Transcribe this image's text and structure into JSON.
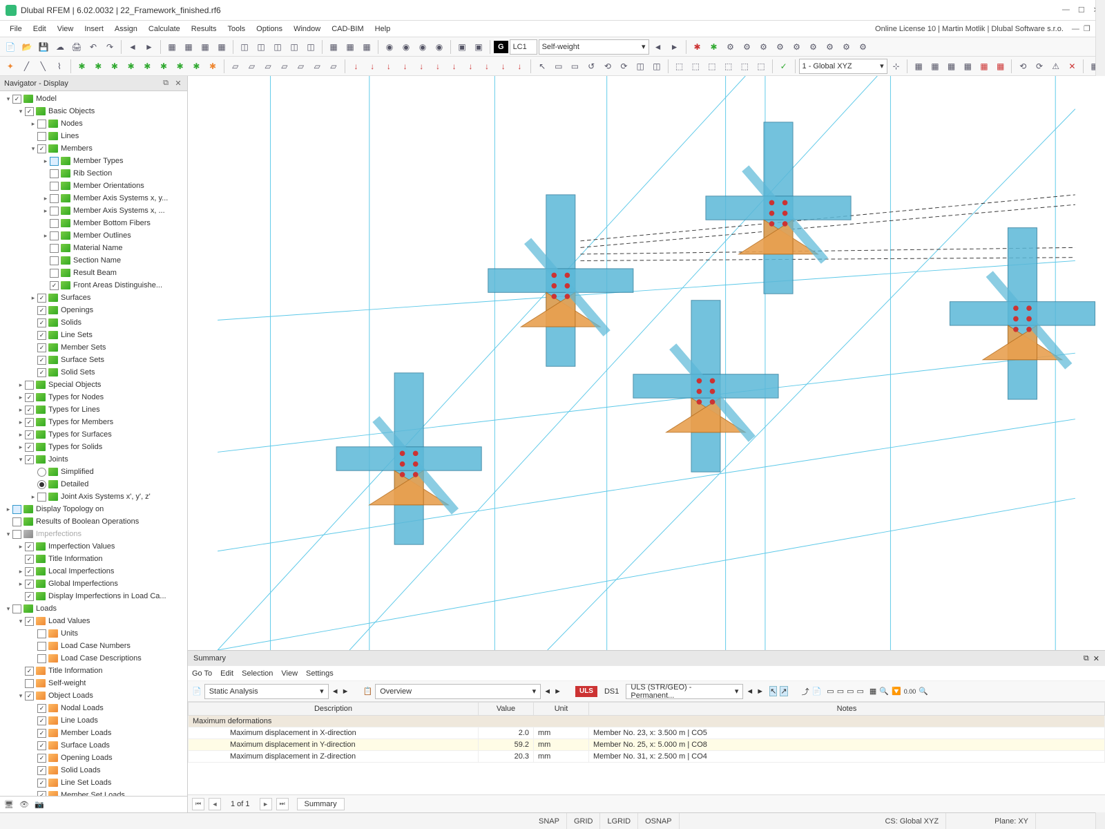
{
  "title": "Dlubal RFEM | 6.02.0032 | 22_Framework_finished.rf6",
  "menubar": [
    "File",
    "Edit",
    "View",
    "Insert",
    "Assign",
    "Calculate",
    "Results",
    "Tools",
    "Options",
    "Window",
    "CAD-BIM",
    "Help"
  ],
  "right_info": "Online License 10 | Martin Motlik | Dlubal Software s.r.o.",
  "toolbar1": {
    "lc_badge": "G",
    "lc_code": "LC1",
    "lc_name": "Self-weight"
  },
  "toolbar2": {
    "cs_combo": "1 - Global XYZ"
  },
  "navigator": {
    "title": "Navigator - Display",
    "tree": [
      {
        "lvl": 0,
        "exp": "▾",
        "chk": 1,
        "ic": "green",
        "label": "Model"
      },
      {
        "lvl": 1,
        "exp": "▾",
        "chk": 1,
        "ic": "green",
        "label": "Basic Objects"
      },
      {
        "lvl": 2,
        "exp": "▸",
        "chk": 0,
        "ic": "green",
        "label": "Nodes"
      },
      {
        "lvl": 2,
        "exp": "",
        "chk": 0,
        "ic": "green",
        "label": "Lines"
      },
      {
        "lvl": 2,
        "exp": "▾",
        "chk": 1,
        "ic": "green",
        "label": "Members"
      },
      {
        "lvl": 3,
        "exp": "▸",
        "chk": 0,
        "chkstyle": "blue",
        "ic": "green",
        "label": "Member Types"
      },
      {
        "lvl": 3,
        "exp": "",
        "chk": 0,
        "ic": "green",
        "label": "Rib Section"
      },
      {
        "lvl": 3,
        "exp": "",
        "chk": 0,
        "ic": "green",
        "label": "Member Orientations"
      },
      {
        "lvl": 3,
        "exp": "▸",
        "chk": 0,
        "ic": "green",
        "label": "Member Axis Systems x, y..."
      },
      {
        "lvl": 3,
        "exp": "▸",
        "chk": 0,
        "ic": "green",
        "label": "Member Axis Systems x, ..."
      },
      {
        "lvl": 3,
        "exp": "",
        "chk": 0,
        "ic": "green",
        "label": "Member Bottom Fibers"
      },
      {
        "lvl": 3,
        "exp": "▸",
        "chk": 0,
        "ic": "green",
        "label": "Member Outlines"
      },
      {
        "lvl": 3,
        "exp": "",
        "chk": 0,
        "ic": "green",
        "label": "Material Name"
      },
      {
        "lvl": 3,
        "exp": "",
        "chk": 0,
        "ic": "green",
        "label": "Section Name"
      },
      {
        "lvl": 3,
        "exp": "",
        "chk": 0,
        "ic": "green",
        "label": "Result Beam"
      },
      {
        "lvl": 3,
        "exp": "",
        "chk": 1,
        "ic": "green",
        "label": "Front Areas Distinguishe..."
      },
      {
        "lvl": 2,
        "exp": "▸",
        "chk": 1,
        "ic": "green",
        "label": "Surfaces"
      },
      {
        "lvl": 2,
        "exp": "",
        "chk": 1,
        "ic": "green",
        "label": "Openings"
      },
      {
        "lvl": 2,
        "exp": "",
        "chk": 1,
        "ic": "green",
        "label": "Solids"
      },
      {
        "lvl": 2,
        "exp": "",
        "chk": 1,
        "ic": "green",
        "label": "Line Sets"
      },
      {
        "lvl": 2,
        "exp": "",
        "chk": 1,
        "ic": "green",
        "label": "Member Sets"
      },
      {
        "lvl": 2,
        "exp": "",
        "chk": 1,
        "ic": "green",
        "label": "Surface Sets"
      },
      {
        "lvl": 2,
        "exp": "",
        "chk": 1,
        "ic": "green",
        "label": "Solid Sets"
      },
      {
        "lvl": 1,
        "exp": "▸",
        "chk": 0,
        "ic": "green",
        "label": "Special Objects"
      },
      {
        "lvl": 1,
        "exp": "▸",
        "chk": 1,
        "ic": "green",
        "label": "Types for Nodes"
      },
      {
        "lvl": 1,
        "exp": "▸",
        "chk": 1,
        "ic": "green",
        "label": "Types for Lines"
      },
      {
        "lvl": 1,
        "exp": "▸",
        "chk": 1,
        "ic": "green",
        "label": "Types for Members"
      },
      {
        "lvl": 1,
        "exp": "▸",
        "chk": 1,
        "ic": "green",
        "label": "Types for Surfaces"
      },
      {
        "lvl": 1,
        "exp": "▸",
        "chk": 1,
        "ic": "green",
        "label": "Types for Solids"
      },
      {
        "lvl": 1,
        "exp": "▾",
        "chk": 1,
        "ic": "green",
        "label": "Joints"
      },
      {
        "lvl": 2,
        "exp": "",
        "radio": 0,
        "ic": "green",
        "label": "Simplified"
      },
      {
        "lvl": 2,
        "exp": "",
        "radio": 1,
        "ic": "green",
        "label": "Detailed"
      },
      {
        "lvl": 2,
        "exp": "▸",
        "chk": 0,
        "ic": "green",
        "label": "Joint Axis Systems x', y', z'"
      },
      {
        "lvl": 0,
        "exp": "▸",
        "chk": 0,
        "chkstyle": "blue",
        "ic": "green",
        "label": "Display Topology on"
      },
      {
        "lvl": 0,
        "exp": "",
        "chk": 0,
        "ic": "green",
        "label": "Results of Boolean Operations"
      },
      {
        "lvl": 0,
        "exp": "▾",
        "chk": 0,
        "ic": "gray",
        "label": "Imperfections",
        "disabled": true
      },
      {
        "lvl": 1,
        "exp": "▸",
        "chk": 1,
        "ic": "green",
        "label": "Imperfection Values"
      },
      {
        "lvl": 1,
        "exp": "",
        "chk": 1,
        "ic": "green",
        "label": "Title Information"
      },
      {
        "lvl": 1,
        "exp": "▸",
        "chk": 1,
        "ic": "green",
        "label": "Local Imperfections"
      },
      {
        "lvl": 1,
        "exp": "▸",
        "chk": 1,
        "ic": "green",
        "label": "Global Imperfections"
      },
      {
        "lvl": 1,
        "exp": "",
        "chk": 1,
        "ic": "green",
        "label": "Display Imperfections in Load Ca..."
      },
      {
        "lvl": 0,
        "exp": "▾",
        "chk": 0,
        "ic": "green",
        "label": "Loads"
      },
      {
        "lvl": 1,
        "exp": "▾",
        "chk": 1,
        "ic": "orange",
        "label": "Load Values"
      },
      {
        "lvl": 2,
        "exp": "",
        "chk": 0,
        "ic": "orange",
        "label": "Units"
      },
      {
        "lvl": 2,
        "exp": "",
        "chk": 0,
        "ic": "orange",
        "label": "Load Case Numbers"
      },
      {
        "lvl": 2,
        "exp": "",
        "chk": 0,
        "ic": "orange",
        "label": "Load Case Descriptions"
      },
      {
        "lvl": 1,
        "exp": "",
        "chk": 1,
        "ic": "orange",
        "label": "Title Information"
      },
      {
        "lvl": 1,
        "exp": "",
        "chk": 0,
        "ic": "orange",
        "label": "Self-weight"
      },
      {
        "lvl": 1,
        "exp": "▾",
        "chk": 1,
        "ic": "orange",
        "label": "Object Loads"
      },
      {
        "lvl": 2,
        "exp": "",
        "chk": 1,
        "ic": "orange",
        "label": "Nodal Loads"
      },
      {
        "lvl": 2,
        "exp": "",
        "chk": 1,
        "ic": "orange",
        "label": "Line Loads"
      },
      {
        "lvl": 2,
        "exp": "",
        "chk": 1,
        "ic": "orange",
        "label": "Member Loads"
      },
      {
        "lvl": 2,
        "exp": "",
        "chk": 1,
        "ic": "orange",
        "label": "Surface Loads"
      },
      {
        "lvl": 2,
        "exp": "",
        "chk": 1,
        "ic": "orange",
        "label": "Opening Loads"
      },
      {
        "lvl": 2,
        "exp": "",
        "chk": 1,
        "ic": "orange",
        "label": "Solid Loads"
      },
      {
        "lvl": 2,
        "exp": "",
        "chk": 1,
        "ic": "orange",
        "label": "Line Set Loads"
      },
      {
        "lvl": 2,
        "exp": "",
        "chk": 1,
        "ic": "orange",
        "label": "Member Set Loads"
      }
    ]
  },
  "summary": {
    "title": "Summary",
    "menus": [
      "Go To",
      "Edit",
      "Selection",
      "View",
      "Settings"
    ],
    "analysis_combo": "Static Analysis",
    "overview_combo": "Overview",
    "uls": "ULS",
    "ds": "DS1",
    "ds_combo": "ULS (STR/GEO) - Permanent...",
    "headers": [
      "Description",
      "Value",
      "Unit",
      "Notes"
    ],
    "group": "Maximum deformations",
    "rows": [
      {
        "desc": "Maximum displacement in X-direction",
        "val": "2.0",
        "unit": "mm",
        "notes": "Member No. 23, x: 3.500 m | CO5"
      },
      {
        "desc": "Maximum displacement in Y-direction",
        "val": "59.2",
        "unit": "mm",
        "notes": "Member No. 25, x: 5.000 m | CO8",
        "hl": true
      },
      {
        "desc": "Maximum displacement in Z-direction",
        "val": "20.3",
        "unit": "mm",
        "notes": "Member No. 31, x: 2.500 m | CO4"
      }
    ],
    "pager": "1 of 1",
    "tab": "Summary"
  },
  "statusbar": {
    "snap": "SNAP",
    "grid": "GRID",
    "lgrid": "LGRID",
    "osnap": "OSNAP",
    "cs": "CS: Global XYZ",
    "plane": "Plane: XY"
  }
}
